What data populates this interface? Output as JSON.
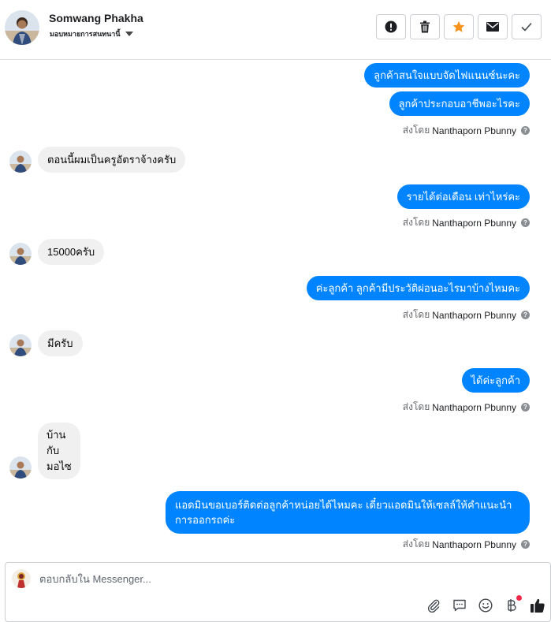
{
  "contact": {
    "name": "Somwang Phakha",
    "assign_label": "มอบหมายการสนทนานี้"
  },
  "actions": [
    {
      "name": "report-icon"
    },
    {
      "name": "trash-icon"
    },
    {
      "name": "star-icon"
    },
    {
      "name": "envelope-icon"
    },
    {
      "name": "checkmark-icon"
    }
  ],
  "colors": {
    "outgoing_bubble": "#0084ff",
    "incoming_bubble": "#f0f0f0",
    "star": "#f7b928"
  },
  "messages": [
    {
      "direction": "out",
      "text": "ลูกค้าสนใจแบบจัดไฟแนนซ์นะคะ"
    },
    {
      "direction": "out",
      "text": "ลูกค้าประกอบอาชีพอะไรคะ"
    },
    {
      "direction": "in",
      "text": "ตอนนี้ผมเป็นครูอัตราจ้างครับ"
    },
    {
      "direction": "out",
      "text": "รายได้ต่อเดือน เท่าไหร่คะ"
    },
    {
      "direction": "in",
      "text": "15000ครับ"
    },
    {
      "direction": "out",
      "text": "ค่ะลูกค้า ลูกค้ามีประวัติผ่อนอะไรมาบ้างไหมคะ"
    },
    {
      "direction": "in",
      "text": "มีครับ"
    },
    {
      "direction": "out",
      "text": "ได้ค่ะลูกค้า"
    },
    {
      "direction": "in",
      "text": "บ้าน กับ มอไซ"
    },
    {
      "direction": "out",
      "text": "แอดมินขอเบอร์ติดต่อลูกค้าหน่อยได้ไหมคะ เดี๋ยวแอดมินให้เซลล์ให้คำแนะนำการออกรถค่ะ"
    }
  ],
  "sent_by": {
    "prefix": "ส่งโดย",
    "agent": "Nanthaporn Pbunny"
  },
  "composer": {
    "placeholder": "ตอบกลับใน Messenger..."
  },
  "composer_tools": [
    {
      "name": "paperclip-icon"
    },
    {
      "name": "saved-reply-icon"
    },
    {
      "name": "emoji-icon"
    },
    {
      "name": "baht-payment-icon"
    },
    {
      "name": "thumbs-up-icon"
    }
  ]
}
